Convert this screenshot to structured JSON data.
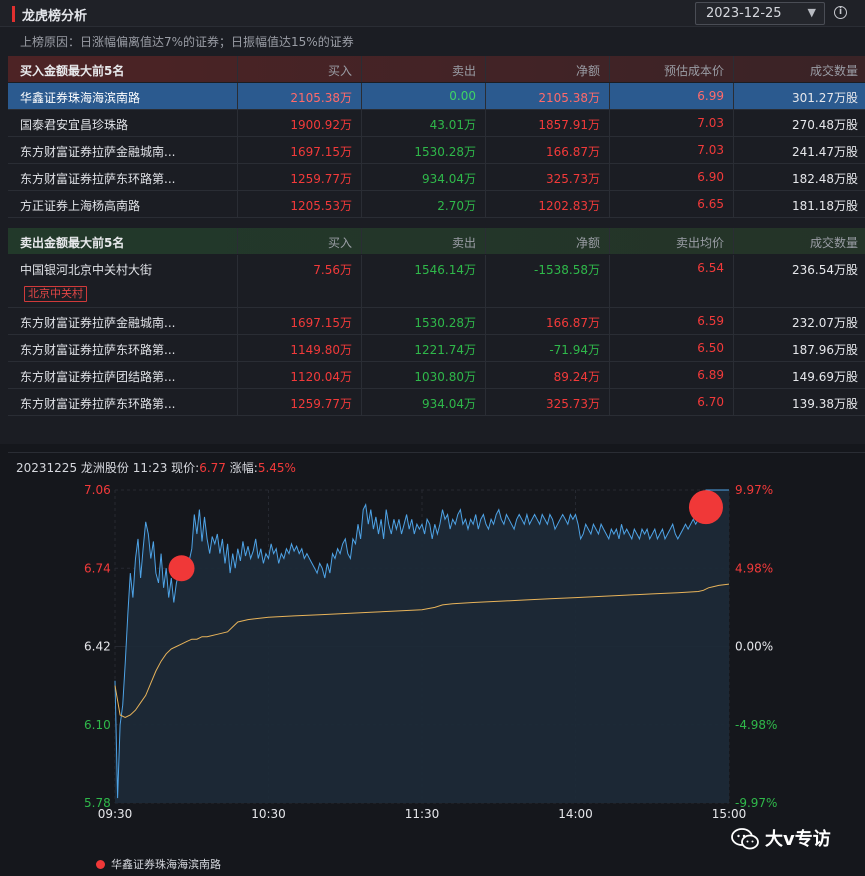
{
  "header": {
    "title": "龙虎榜分析",
    "date": "2023-12-25",
    "reason": "上榜原因：日涨幅偏离值达7%的证券；日振幅值达15%的证券"
  },
  "buy_table": {
    "title": "买入金额最大前5名",
    "columns": [
      "买入",
      "卖出",
      "净额",
      "预估成本价",
      "成交数量"
    ],
    "rows": [
      {
        "name": "华鑫证券珠海海滨南路",
        "buy": "2105.38万",
        "sell": "0.00",
        "net": "2105.38万",
        "price": "6.99",
        "volume": "301.27万股"
      },
      {
        "name": "国泰君安宜昌珍珠路",
        "buy": "1900.92万",
        "sell": "43.01万",
        "net": "1857.91万",
        "price": "7.03",
        "volume": "270.48万股"
      },
      {
        "name": "东方财富证券拉萨金融城南...",
        "buy": "1697.15万",
        "sell": "1530.28万",
        "net": "166.87万",
        "price": "7.03",
        "volume": "241.47万股"
      },
      {
        "name": "东方财富证券拉萨东环路第...",
        "buy": "1259.77万",
        "sell": "934.04万",
        "net": "325.73万",
        "price": "6.90",
        "volume": "182.48万股"
      },
      {
        "name": "方正证券上海杨高南路",
        "buy": "1205.53万",
        "sell": "2.70万",
        "net": "1202.83万",
        "price": "6.65",
        "volume": "181.18万股"
      }
    ]
  },
  "sell_table": {
    "title": "卖出金额最大前5名",
    "columns": [
      "买入",
      "卖出",
      "净额",
      "卖出均价",
      "成交数量"
    ],
    "rows": [
      {
        "name": "中国银河北京中关村大街",
        "tag": "北京中关村",
        "buy": "7.56万",
        "sell": "1546.14万",
        "net": "-1538.58万",
        "price": "6.54",
        "volume": "236.54万股"
      },
      {
        "name": "东方财富证券拉萨金融城南...",
        "buy": "1697.15万",
        "sell": "1530.28万",
        "net": "166.87万",
        "price": "6.59",
        "volume": "232.07万股"
      },
      {
        "name": "东方财富证券拉萨东环路第...",
        "buy": "1149.80万",
        "sell": "1221.74万",
        "net": "-71.94万",
        "price": "6.50",
        "volume": "187.96万股"
      },
      {
        "name": "东方财富证券拉萨团结路第...",
        "buy": "1120.04万",
        "sell": "1030.80万",
        "net": "89.24万",
        "price": "6.89",
        "volume": "149.69万股"
      },
      {
        "name": "东方财富证券拉萨东环路第...",
        "buy": "1259.77万",
        "sell": "934.04万",
        "net": "325.73万",
        "price": "6.70",
        "volume": "139.38万股"
      }
    ]
  },
  "chart_info": {
    "date": "20231225",
    "stock": "龙洲股份",
    "time": "11:23",
    "price_label": "现价:",
    "price": "6.77",
    "change_label": "涨幅:",
    "change": "5.45%"
  },
  "legend": {
    "label": "华鑫证券珠海海滨南路"
  },
  "watermark": "大v专访",
  "colors": {
    "up": "#f23a3a",
    "down": "#2fb84a",
    "price_line": "#4ea3e6",
    "avg_line": "#e7b35a",
    "marker": "#f03838"
  },
  "chart_data": {
    "type": "line",
    "y_left_ticks": [
      "7.06",
      "6.74",
      "6.42",
      "6.10",
      "5.78"
    ],
    "y_right_ticks": [
      "9.97%",
      "4.98%",
      "0.00%",
      "-4.98%",
      "-9.97%"
    ],
    "ylim": [
      5.78,
      7.06
    ],
    "x_ticks": [
      "09:30",
      "10:30",
      "11:30",
      "14:00",
      "15:00"
    ],
    "minutes_total": 240,
    "price_series": [
      [
        0,
        6.28
      ],
      [
        1,
        5.8
      ],
      [
        2,
        6.1
      ],
      [
        3,
        6.18
      ],
      [
        4,
        6.35
      ],
      [
        5,
        6.55
      ],
      [
        6,
        6.72
      ],
      [
        7,
        6.62
      ],
      [
        8,
        6.78
      ],
      [
        9,
        6.86
      ],
      [
        10,
        6.7
      ],
      [
        11,
        6.82
      ],
      [
        12,
        6.93
      ],
      [
        13,
        6.88
      ],
      [
        14,
        6.78
      ],
      [
        15,
        6.85
      ],
      [
        16,
        6.72
      ],
      [
        17,
        6.68
      ],
      [
        18,
        6.8
      ],
      [
        19,
        6.66
      ],
      [
        20,
        6.74
      ],
      [
        21,
        6.62
      ],
      [
        22,
        6.7
      ],
      [
        23,
        6.6
      ],
      [
        24,
        6.68
      ],
      [
        25,
        6.72
      ],
      [
        26,
        6.78
      ],
      [
        27,
        6.73
      ],
      [
        28,
        6.75
      ],
      [
        29,
        6.77
      ],
      [
        30,
        6.82
      ],
      [
        31,
        6.96
      ],
      [
        32,
        6.88
      ],
      [
        33,
        6.98
      ],
      [
        34,
        6.85
      ],
      [
        35,
        6.95
      ],
      [
        36,
        6.86
      ],
      [
        37,
        6.8
      ],
      [
        38,
        6.87
      ],
      [
        39,
        6.84
      ],
      [
        40,
        6.88
      ],
      [
        41,
        6.8
      ],
      [
        42,
        6.86
      ],
      [
        43,
        6.76
      ],
      [
        44,
        6.84
      ],
      [
        45,
        6.72
      ],
      [
        46,
        6.8
      ],
      [
        47,
        6.74
      ],
      [
        48,
        6.82
      ],
      [
        49,
        6.77
      ],
      [
        50,
        6.85
      ],
      [
        51,
        6.79
      ],
      [
        52,
        6.83
      ],
      [
        53,
        6.78
      ],
      [
        54,
        6.81
      ],
      [
        55,
        6.86
      ],
      [
        56,
        6.78
      ],
      [
        57,
        6.82
      ],
      [
        58,
        6.76
      ],
      [
        59,
        6.8
      ],
      [
        60,
        6.78
      ],
      [
        61,
        6.84
      ],
      [
        62,
        6.8
      ],
      [
        63,
        6.82
      ],
      [
        64,
        6.76
      ],
      [
        65,
        6.8
      ],
      [
        66,
        6.78
      ],
      [
        67,
        6.82
      ],
      [
        68,
        6.8
      ],
      [
        69,
        6.84
      ],
      [
        70,
        6.81
      ],
      [
        71,
        6.83
      ],
      [
        72,
        6.8
      ],
      [
        73,
        6.82
      ],
      [
        74,
        6.78
      ],
      [
        75,
        6.8
      ],
      [
        76,
        6.78
      ],
      [
        77,
        6.76
      ],
      [
        78,
        6.74
      ],
      [
        79,
        6.72
      ],
      [
        80,
        6.76
      ],
      [
        81,
        6.74
      ],
      [
        82,
        6.7
      ],
      [
        83,
        6.76
      ],
      [
        84,
        6.72
      ],
      [
        85,
        6.8
      ],
      [
        86,
        6.78
      ],
      [
        87,
        6.82
      ],
      [
        88,
        6.8
      ],
      [
        89,
        6.84
      ],
      [
        90,
        6.86
      ],
      [
        91,
        6.8
      ],
      [
        92,
        6.78
      ],
      [
        93,
        6.86
      ],
      [
        94,
        6.84
      ],
      [
        95,
        6.92
      ],
      [
        96,
        6.86
      ],
      [
        97,
        6.98
      ],
      [
        98,
        7.0
      ],
      [
        99,
        6.92
      ],
      [
        100,
        6.98
      ],
      [
        101,
        6.9
      ],
      [
        102,
        6.95
      ],
      [
        103,
        6.88
      ],
      [
        104,
        6.94
      ],
      [
        105,
        6.86
      ],
      [
        106,
        6.98
      ],
      [
        107,
        6.92
      ],
      [
        108,
        6.88
      ],
      [
        109,
        6.94
      ],
      [
        110,
        6.9
      ],
      [
        111,
        6.94
      ],
      [
        112,
        6.88
      ],
      [
        113,
        6.92
      ],
      [
        114,
        6.96
      ],
      [
        115,
        6.9
      ],
      [
        116,
        6.94
      ],
      [
        117,
        6.88
      ],
      [
        118,
        6.92
      ],
      [
        119,
        6.9
      ],
      [
        120,
        6.92
      ],
      [
        121,
        6.88
      ],
      [
        122,
        6.94
      ],
      [
        123,
        6.92
      ],
      [
        124,
        6.86
      ],
      [
        125,
        6.92
      ],
      [
        126,
        6.88
      ],
      [
        127,
        6.92
      ],
      [
        128,
        6.98
      ],
      [
        129,
        6.94
      ],
      [
        130,
        6.96
      ],
      [
        131,
        6.9
      ],
      [
        132,
        6.94
      ],
      [
        133,
        6.92
      ],
      [
        134,
        6.96
      ],
      [
        135,
        6.98
      ],
      [
        136,
        6.92
      ],
      [
        137,
        6.94
      ],
      [
        138,
        6.9
      ],
      [
        139,
        6.94
      ],
      [
        140,
        6.92
      ],
      [
        141,
        6.96
      ],
      [
        142,
        6.9
      ],
      [
        143,
        6.94
      ],
      [
        144,
        6.96
      ],
      [
        145,
        6.92
      ],
      [
        146,
        6.9
      ],
      [
        147,
        6.94
      ],
      [
        148,
        6.92
      ],
      [
        149,
        6.96
      ],
      [
        150,
        6.98
      ],
      [
        151,
        6.94
      ],
      [
        152,
        6.92
      ],
      [
        153,
        6.96
      ],
      [
        154,
        6.94
      ],
      [
        155,
        6.92
      ],
      [
        156,
        6.9
      ],
      [
        157,
        6.94
      ],
      [
        158,
        6.96
      ],
      [
        159,
        6.94
      ],
      [
        160,
        6.92
      ],
      [
        161,
        6.96
      ],
      [
        162,
        6.92
      ],
      [
        163,
        6.94
      ],
      [
        164,
        6.96
      ],
      [
        165,
        6.94
      ],
      [
        166,
        6.92
      ],
      [
        167,
        6.96
      ],
      [
        168,
        6.94
      ],
      [
        169,
        6.92
      ],
      [
        170,
        6.96
      ],
      [
        171,
        6.94
      ],
      [
        172,
        6.9
      ],
      [
        173,
        6.92
      ],
      [
        174,
        6.94
      ],
      [
        175,
        6.96
      ],
      [
        176,
        6.94
      ],
      [
        177,
        6.92
      ],
      [
        178,
        6.96
      ],
      [
        179,
        6.94
      ],
      [
        180,
        6.96
      ],
      [
        181,
        6.92
      ],
      [
        182,
        6.86
      ],
      [
        183,
        6.88
      ],
      [
        184,
        6.92
      ],
      [
        185,
        6.9
      ],
      [
        186,
        6.88
      ],
      [
        187,
        6.92
      ],
      [
        188,
        6.9
      ],
      [
        189,
        6.88
      ],
      [
        190,
        6.92
      ],
      [
        191,
        6.9
      ],
      [
        192,
        6.88
      ],
      [
        193,
        6.86
      ],
      [
        194,
        6.9
      ],
      [
        195,
        6.88
      ],
      [
        196,
        6.9
      ],
      [
        197,
        6.86
      ],
      [
        198,
        6.92
      ],
      [
        199,
        6.88
      ],
      [
        200,
        6.9
      ],
      [
        201,
        6.88
      ],
      [
        202,
        6.86
      ],
      [
        203,
        6.9
      ],
      [
        204,
        6.88
      ],
      [
        205,
        6.86
      ],
      [
        206,
        6.9
      ],
      [
        207,
        6.88
      ],
      [
        208,
        6.9
      ],
      [
        209,
        6.86
      ],
      [
        210,
        6.88
      ],
      [
        211,
        6.9
      ],
      [
        212,
        6.86
      ],
      [
        213,
        6.88
      ],
      [
        214,
        6.9
      ],
      [
        215,
        6.86
      ],
      [
        216,
        6.88
      ],
      [
        217,
        6.9
      ],
      [
        218,
        6.92
      ],
      [
        219,
        6.88
      ],
      [
        220,
        6.86
      ],
      [
        221,
        6.88
      ],
      [
        222,
        6.9
      ],
      [
        223,
        6.92
      ],
      [
        224,
        6.9
      ],
      [
        225,
        6.92
      ],
      [
        226,
        6.94
      ],
      [
        227,
        6.92
      ],
      [
        228,
        6.94
      ],
      [
        229,
        6.96
      ],
      [
        230,
        7.0
      ],
      [
        231,
        7.06
      ],
      [
        232,
        7.06
      ],
      [
        233,
        7.06
      ],
      [
        234,
        7.06
      ],
      [
        235,
        7.06
      ],
      [
        236,
        7.06
      ],
      [
        237,
        7.06
      ],
      [
        238,
        7.06
      ],
      [
        240,
        7.06
      ]
    ],
    "avg_series": [
      [
        0,
        6.26
      ],
      [
        2,
        6.14
      ],
      [
        4,
        6.13
      ],
      [
        6,
        6.14
      ],
      [
        8,
        6.16
      ],
      [
        10,
        6.19
      ],
      [
        12,
        6.22
      ],
      [
        14,
        6.27
      ],
      [
        16,
        6.32
      ],
      [
        18,
        6.36
      ],
      [
        20,
        6.39
      ],
      [
        22,
        6.41
      ],
      [
        24,
        6.42
      ],
      [
        26,
        6.43
      ],
      [
        28,
        6.44
      ],
      [
        30,
        6.45
      ],
      [
        32,
        6.45
      ],
      [
        34,
        6.46
      ],
      [
        36,
        6.46
      ],
      [
        40,
        6.47
      ],
      [
        44,
        6.48
      ],
      [
        46,
        6.5
      ],
      [
        48,
        6.52
      ],
      [
        52,
        6.53
      ],
      [
        60,
        6.54
      ],
      [
        70,
        6.545
      ],
      [
        80,
        6.55
      ],
      [
        90,
        6.555
      ],
      [
        100,
        6.56
      ],
      [
        110,
        6.565
      ],
      [
        120,
        6.57
      ],
      [
        125,
        6.58
      ],
      [
        128,
        6.59
      ],
      [
        132,
        6.595
      ],
      [
        140,
        6.6
      ],
      [
        150,
        6.605
      ],
      [
        160,
        6.61
      ],
      [
        170,
        6.615
      ],
      [
        180,
        6.62
      ],
      [
        190,
        6.625
      ],
      [
        200,
        6.63
      ],
      [
        210,
        6.635
      ],
      [
        220,
        6.64
      ],
      [
        228,
        6.645
      ],
      [
        230,
        6.65
      ],
      [
        232,
        6.66
      ],
      [
        234,
        6.665
      ],
      [
        236,
        6.67
      ],
      [
        240,
        6.675
      ]
    ],
    "markers": [
      {
        "label": "华鑫证券珠海海滨南路",
        "t": 26,
        "price": 6.74,
        "r": 13
      },
      {
        "label": "华鑫证券珠海海滨南路",
        "t": 231,
        "price": 6.99,
        "r": 17
      }
    ]
  }
}
